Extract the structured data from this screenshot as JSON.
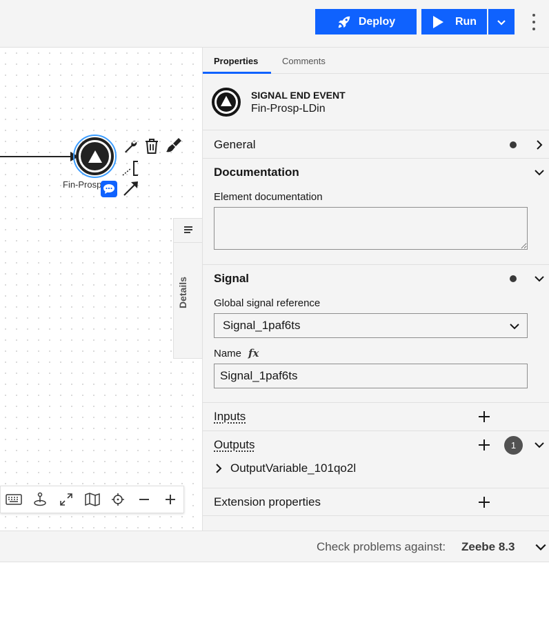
{
  "toolbar": {
    "deploy_label": "Deploy",
    "run_label": "Run"
  },
  "canvas": {
    "event_label": "Fin-Prosp-LD"
  },
  "details_tab": {
    "label": "Details"
  },
  "panel": {
    "tabs": [
      {
        "label": "Properties",
        "active": true
      },
      {
        "label": "Comments",
        "active": false
      }
    ],
    "element": {
      "type": "SIGNAL END EVENT",
      "name": "Fin-Prosp-LDin"
    },
    "groups": {
      "general": {
        "title": "General"
      },
      "documentation": {
        "title": "Documentation",
        "field_label": "Element documentation",
        "value": ""
      },
      "signal": {
        "title": "Signal",
        "ref_label": "Global signal reference",
        "ref_value": "Signal_1paf6ts",
        "name_label": "Name",
        "name_fx": "fx",
        "name_value": "Signal_1paf6ts"
      },
      "inputs": {
        "title": "Inputs"
      },
      "outputs": {
        "title": "Outputs",
        "count": "1",
        "items": [
          "OutputVariable_101qo2l"
        ]
      },
      "extension": {
        "title": "Extension properties"
      }
    }
  },
  "footer": {
    "label": "Check problems against:",
    "value": "Zeebe 8.3"
  },
  "colors": {
    "accent": "#0f62fe",
    "selection": "#3b9cff"
  }
}
